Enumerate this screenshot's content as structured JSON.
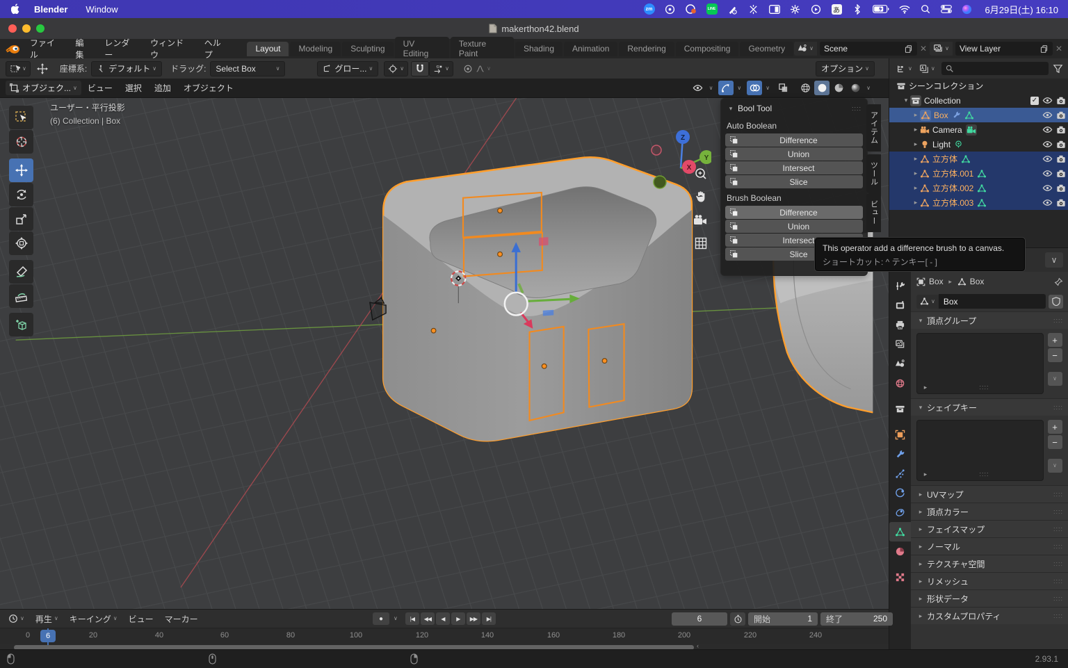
{
  "menubar": {
    "app": "Blender",
    "menu": "Window",
    "clock": "6月29日(土) 16:10",
    "zoom_badge": "zm",
    "line_badge": "LINE",
    "ime": "あ"
  },
  "titlebar": {
    "title": "makerthon42.blend"
  },
  "topbar": {
    "menus": [
      "ファイル",
      "編集",
      "レンダー",
      "ウィンドウ",
      "ヘルプ"
    ],
    "tabs": [
      "Layout",
      "Modeling",
      "Sculpting",
      "UV Editing",
      "Texture Paint",
      "Shading",
      "Animation",
      "Rendering",
      "Compositing",
      "Geometry"
    ],
    "active_tab": "Layout",
    "scene_label": "Scene",
    "view_layer_label": "View Layer"
  },
  "tools": {
    "orientation_label": "座標系:",
    "orientation": "デフォルト",
    "drag_label": "ドラッグ:",
    "drag": "Select Box",
    "pivot": "グロー...",
    "options": "オプション"
  },
  "viewport": {
    "mode": "オブジェク...",
    "menus": [
      "ビュー",
      "選択",
      "追加",
      "オブジェクト"
    ],
    "proj": "ユーザー・平行投影",
    "coll": "(6) Collection | Box",
    "axes": {
      "z": "Z",
      "y": "Y",
      "x": "X"
    }
  },
  "sidebar_tabs": [
    "アイテム",
    "ツール",
    "ビュー"
  ],
  "bool_tool": {
    "title": "Bool Tool",
    "auto": "Auto Boolean",
    "brush": "Brush Boolean",
    "buttons": [
      "Difference",
      "Union",
      "Intersect",
      "Slice"
    ]
  },
  "tooltip": {
    "l1": "This operator add a difference brush to a canvas.",
    "l2": "ショートカット: ^ テンキー[ - ]"
  },
  "outliner": {
    "rows": [
      {
        "name": "シーンコレクション"
      },
      {
        "name": "Collection"
      },
      {
        "name": "Box"
      },
      {
        "name": "Camera"
      },
      {
        "name": "Light"
      },
      {
        "name": "立方体"
      },
      {
        "name": "立方体.001"
      },
      {
        "name": "立方体.002"
      },
      {
        "name": "立方体.003"
      }
    ]
  },
  "props": {
    "crumb1": "Box",
    "crumb2": "Box",
    "name": "Box",
    "sec_vertex_groups": "頂点グループ",
    "sec_shape_keys": "シェイプキー",
    "closed": [
      "UVマップ",
      "頂点カラー",
      "フェイスマップ",
      "ノーマル",
      "テクスチャ空間",
      "リメッシュ",
      "形状データ",
      "カスタムプロパティ"
    ]
  },
  "timeline": {
    "menus": [
      "再生",
      "キーイング",
      "ビュー",
      "マーカー"
    ],
    "frame": "6",
    "badge": "6",
    "start_label": "開始",
    "start": "1",
    "end_label": "終了",
    "end": "250",
    "ruler": [
      "0",
      "20",
      "40",
      "60",
      "80",
      "100",
      "120",
      "140",
      "160",
      "180",
      "200",
      "220",
      "240"
    ]
  },
  "status": {
    "version": "2.93.1"
  }
}
